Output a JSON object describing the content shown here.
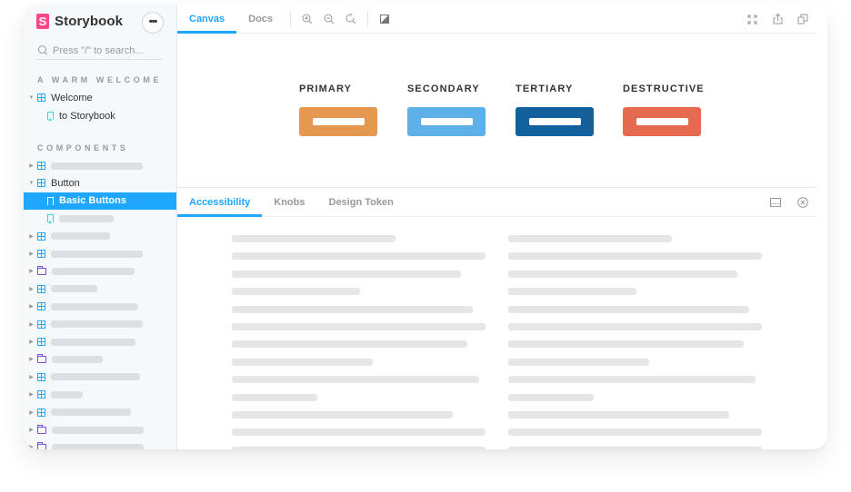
{
  "sidebar": {
    "brand": {
      "logo_letter": "S",
      "name": "Storybook",
      "logo_color": "#ff4785"
    },
    "menu_button_label": "•••",
    "search": {
      "placeholder": "Press \"/\" to search...",
      "value": ""
    },
    "sections": [
      {
        "title": "A WARM WELCOME",
        "items": [
          {
            "type": "component",
            "label": "Welcome",
            "expanded": true
          },
          {
            "type": "story",
            "label": "to Storybook"
          }
        ]
      },
      {
        "title": "COMPONENTS",
        "items": [
          {
            "type": "component",
            "label": "",
            "placeholder": true
          },
          {
            "type": "component",
            "label": "Button",
            "expanded": true
          },
          {
            "type": "story",
            "label": "Basic Buttons",
            "selected": true
          },
          {
            "type": "story",
            "label": "",
            "placeholder": true
          },
          {
            "type": "component",
            "label": "",
            "placeholder": true
          },
          {
            "type": "component",
            "label": "",
            "placeholder": true
          },
          {
            "type": "folder",
            "label": "",
            "placeholder": true
          },
          {
            "type": "component",
            "label": "",
            "placeholder": true
          },
          {
            "type": "component",
            "label": "",
            "placeholder": true
          },
          {
            "type": "component",
            "label": "",
            "placeholder": true
          },
          {
            "type": "component",
            "label": "",
            "placeholder": true
          },
          {
            "type": "folder",
            "label": "",
            "placeholder": true
          },
          {
            "type": "component",
            "label": "",
            "placeholder": true
          },
          {
            "type": "component",
            "label": "",
            "placeholder": true
          },
          {
            "type": "component",
            "label": "",
            "placeholder": true
          },
          {
            "type": "folder",
            "label": "",
            "placeholder": true
          },
          {
            "type": "folder",
            "label": "",
            "placeholder": true
          }
        ]
      }
    ],
    "accent_color": "#1ea7fd"
  },
  "toolbar": {
    "tabs": [
      {
        "label": "Canvas",
        "active": true
      },
      {
        "label": "Docs",
        "active": false
      }
    ],
    "tools": [
      "zoom-in-icon",
      "zoom-out-icon",
      "zoom-reset-icon",
      "background-icon"
    ],
    "right_tools": [
      "fullscreen-icon",
      "share-icon",
      "copy-icon"
    ]
  },
  "canvas": {
    "buttons": [
      {
        "title": "PRIMARY",
        "color": "#e5984f"
      },
      {
        "title": "SECONDARY",
        "color": "#5eb0e8"
      },
      {
        "title": "TERTIARY",
        "color": "#12609c"
      },
      {
        "title": "DESTRUCTIVE",
        "color": "#e56a4f"
      }
    ]
  },
  "addons": {
    "tabs": [
      {
        "label": "Accessibility",
        "active": true
      },
      {
        "label": "Knobs",
        "active": false
      },
      {
        "label": "Design Token",
        "active": false
      }
    ],
    "tools": [
      "panel-position-icon",
      "close-panel-icon"
    ]
  }
}
